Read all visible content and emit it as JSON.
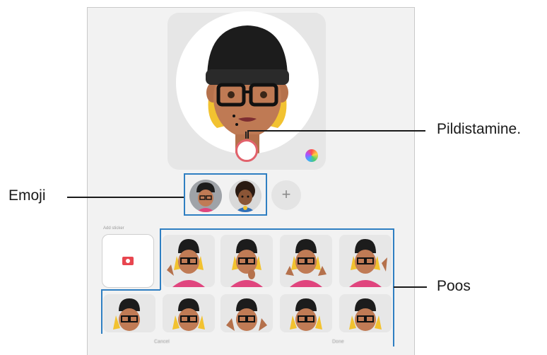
{
  "screen": {
    "add_sticker_label": "Add sticker",
    "add_emoji_symbol": "+",
    "cancel_label": "Cancel",
    "done_label": "Done"
  },
  "callouts": {
    "capture": "Pildistamine.",
    "emoji": "Emoji",
    "poses": "Poos"
  },
  "colors": {
    "highlight": "#2f7fc2",
    "shutter_ring": "#e2626c",
    "camera_icon": "#e8464f"
  },
  "icons": [
    "avatar-face-icon",
    "color-wheel-icon",
    "camera-icon",
    "plus-icon"
  ]
}
